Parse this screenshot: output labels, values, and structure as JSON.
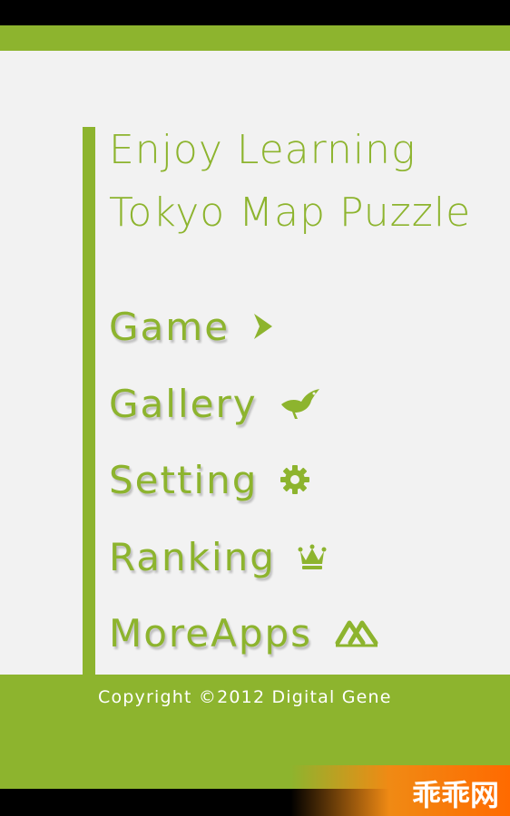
{
  "title": {
    "line1": "Enjoy Learning",
    "line2": "Tokyo Map Puzzle"
  },
  "menu": {
    "items": [
      {
        "label": "Game",
        "icon": "play-arrow-icon"
      },
      {
        "label": "Gallery",
        "icon": "bird-icon"
      },
      {
        "label": "Setting",
        "icon": "gear-icon"
      },
      {
        "label": "Ranking",
        "icon": "crown-icon"
      },
      {
        "label": "MoreApps",
        "icon": "more-apps-logo-icon"
      }
    ]
  },
  "footer": {
    "copyright": "Copyright  ©2012 Digital Gene"
  },
  "watermark": {
    "text": "乖乖网"
  },
  "colors": {
    "accent": "#8db42e",
    "background": "#f2f2f2",
    "footer_text": "#ffffff"
  }
}
